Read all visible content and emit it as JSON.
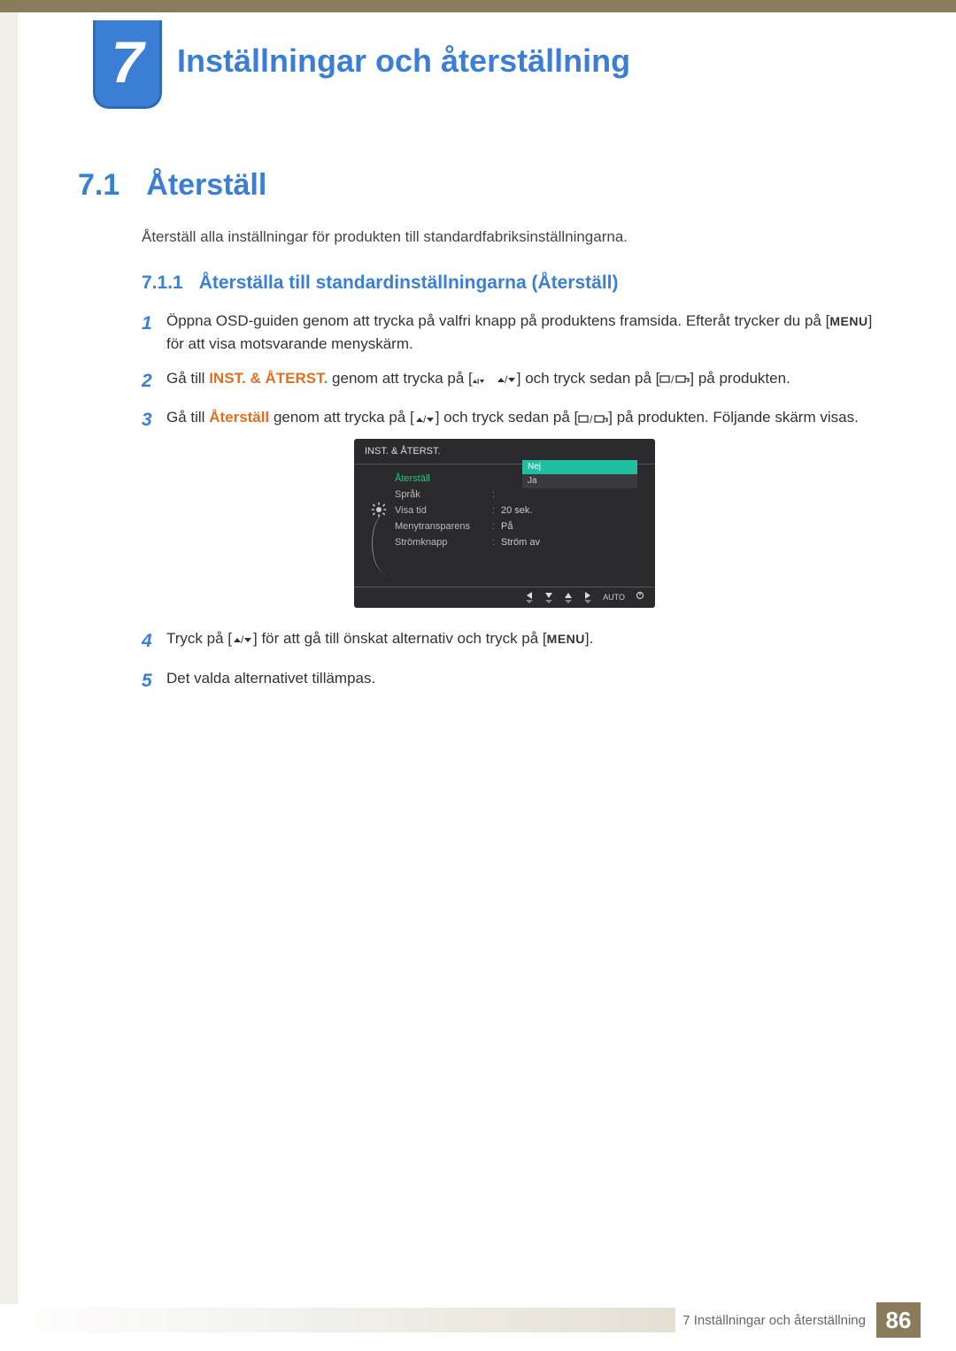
{
  "chapter": {
    "number": "7",
    "title": "Inställningar och återställning"
  },
  "section": {
    "number": "7.1",
    "title": "Återställ"
  },
  "intro": "Återställ alla inställningar för produkten till standardfabriksinställningarna.",
  "subsection": {
    "number": "7.1.1",
    "title": "Återställa till standardinställningarna (Återställ)"
  },
  "steps": {
    "s1": {
      "num": "1",
      "part1": "Öppna OSD-guiden genom att trycka på valfri knapp på produktens framsida. Efteråt trycker du på [",
      "menu": "MENU",
      "part2": "] för att visa motsvarande menyskärm."
    },
    "s2": {
      "num": "2",
      "part1": "Gå till ",
      "emph": "INST. & ÅTERST.",
      "part2": " genom att trycka på [",
      "part3": "] och tryck sedan på [",
      "part4": "] på produkten."
    },
    "s3": {
      "num": "3",
      "part1": "Gå till ",
      "emph": "Återställ",
      "part2": " genom att trycka på [",
      "part3": "] och tryck sedan på [",
      "part4": "] på produkten. Följande skärm visas."
    },
    "s4": {
      "num": "4",
      "part1": "Tryck på [",
      "part2": "] för att gå till önskat alternativ och tryck på [",
      "menu": "MENU",
      "part3": "]."
    },
    "s5": {
      "num": "5",
      "text": "Det valda alternativet tillämpas."
    }
  },
  "osd": {
    "header": "INST. & ÅTERST.",
    "items": [
      {
        "label": "Återställ",
        "value": "",
        "active": true
      },
      {
        "label": "Språk",
        "value": ""
      },
      {
        "label": "Visa tid",
        "value": "20 sek."
      },
      {
        "label": "Menytransparens",
        "value": "På"
      },
      {
        "label": "Strömknapp",
        "value": "Ström av"
      }
    ],
    "popup": {
      "selected": "Nej",
      "other": "Ja"
    },
    "footer_auto": "AUTO"
  },
  "footer": {
    "text": "7 Inställningar och återställning",
    "page": "86"
  }
}
